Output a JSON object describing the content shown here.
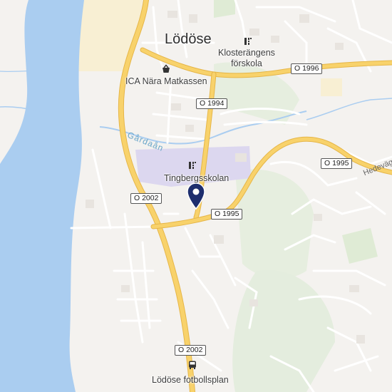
{
  "map": {
    "colors": {
      "water": "#aacdf0",
      "land": "#f4f2ef",
      "green": "#e2ecdc",
      "school_area": "#dcd7ef",
      "major_road": "#f7cd62",
      "pin": "#1e2e6e"
    },
    "place_label": "Lödöse",
    "river_label": "Gårdaån",
    "road_name_label": "Hedeväge",
    "pois": [
      {
        "name": "Klosterängens\nförskola",
        "icon": "school-icon"
      },
      {
        "name": "ICA Nära Matkassen",
        "icon": "shopping-basket-icon"
      },
      {
        "name": "Tingbergsskolan",
        "icon": "school-icon"
      },
      {
        "name": "Lödöse fotbollsplan",
        "icon": "bus-icon"
      }
    ],
    "route_shields": [
      "O 1996",
      "O 1994",
      "O 1995",
      "O 2002",
      "O 1995",
      "O 2002"
    ],
    "pin": {
      "icon": "location-pin-icon"
    }
  }
}
